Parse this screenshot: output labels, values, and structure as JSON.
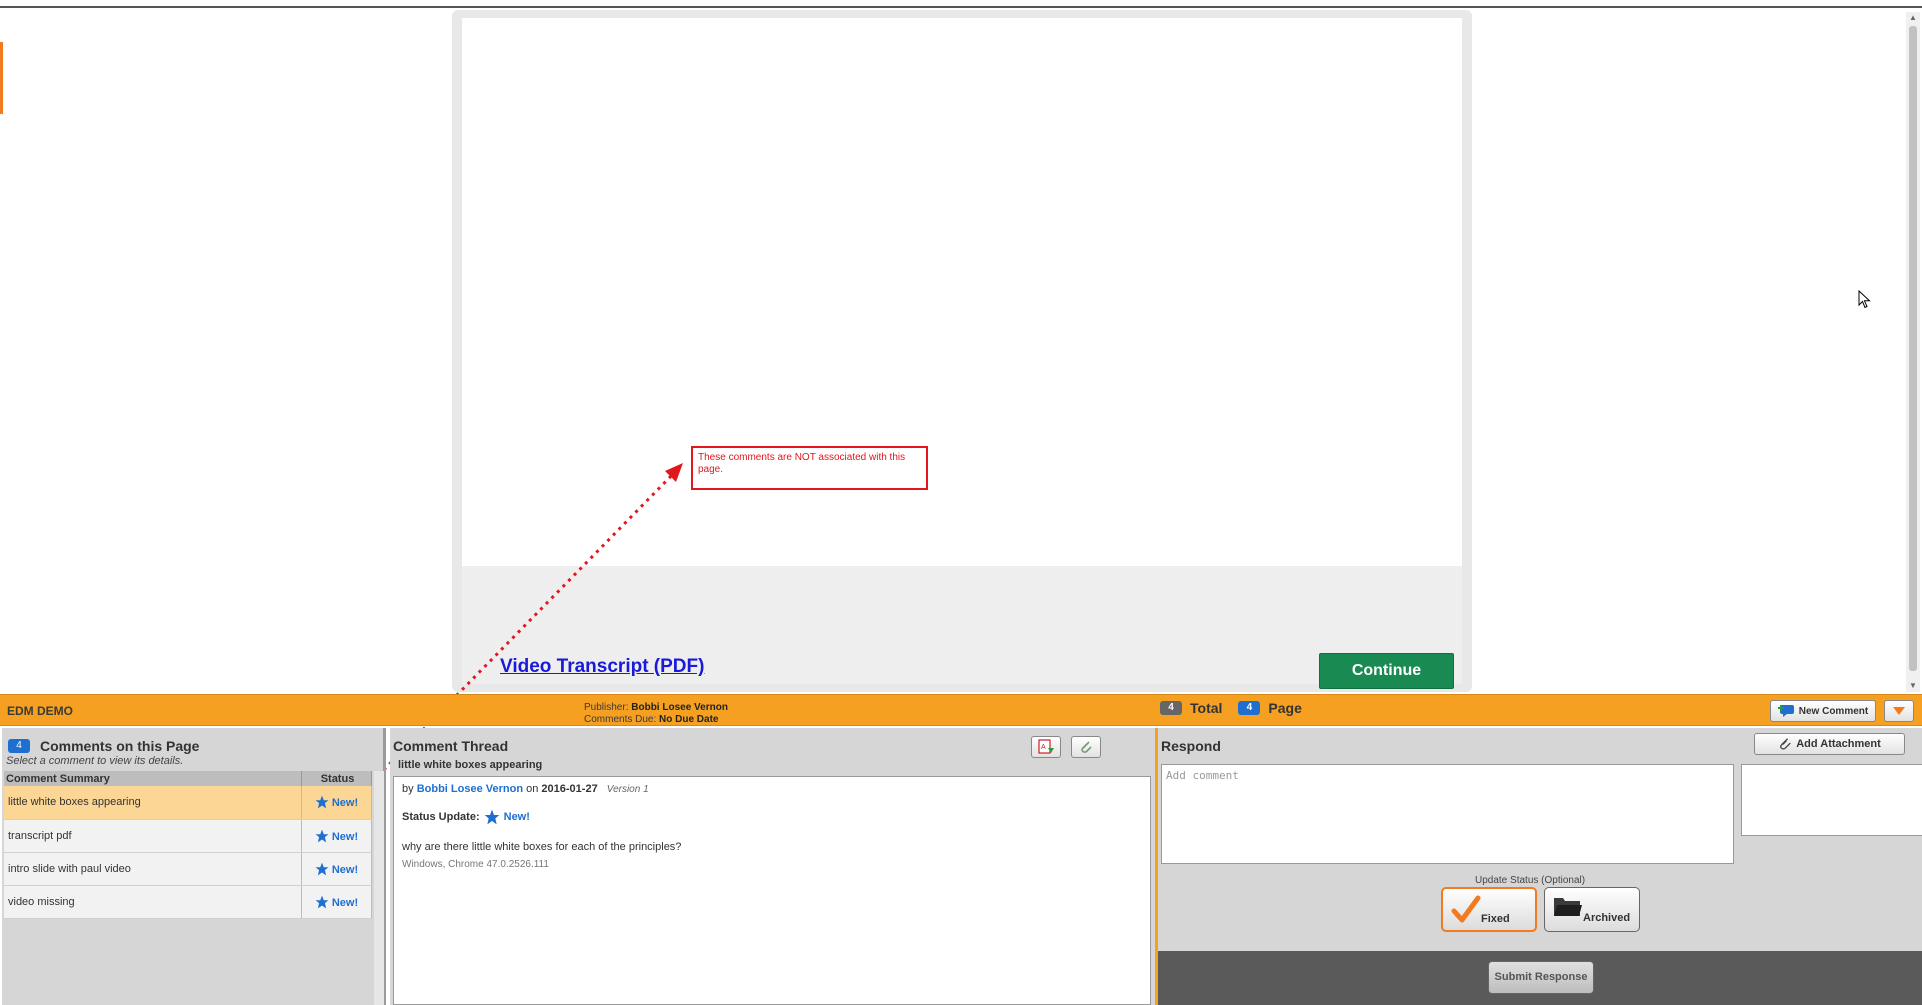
{
  "content": {
    "transcript_link": "Video Transcript (PDF)",
    "continue_label": "Continue",
    "note": "These comments are NOT associated with this page."
  },
  "toolbar": {
    "app_title": "EDM DEMO",
    "publisher_label": "Publisher:",
    "publisher_name": "Bobbi Losee Vernon",
    "due_label": "Comments Due:",
    "due_value": "No Due Date",
    "total_count": "4",
    "total_label": "Total",
    "page_count": "4",
    "page_label": "Page",
    "new_comment_label": "New Comment"
  },
  "comments_panel": {
    "count": "4",
    "title": "Comments on this Page",
    "subtitle": "Select a comment to view its details.",
    "col_summary": "Comment Summary",
    "col_status": "Status",
    "rows": [
      {
        "summary": "little white boxes appearing",
        "status": "New!"
      },
      {
        "summary": "transcript pdf",
        "status": "New!"
      },
      {
        "summary": "intro slide with paul video",
        "status": "New!"
      },
      {
        "summary": "video missing",
        "status": "New!"
      }
    ]
  },
  "thread_panel": {
    "title": "Comment Thread",
    "subtitle": "little white boxes appearing",
    "by_label": "by",
    "author": "Bobbi Losee Vernon",
    "on_label": "on",
    "date": "2016-01-27",
    "version": "Version 1",
    "status_update_label": "Status Update:",
    "status_value": "New!",
    "body": "why are there little white boxes for each of the principles?",
    "environment": "Windows, Chrome 47.0.2526.111"
  },
  "respond_panel": {
    "title": "Respond",
    "add_attachment_label": "Add Attachment",
    "comment_placeholder": "Add comment",
    "update_status_label": "Update Status (Optional)",
    "fixed_label": "Fixed",
    "archived_label": "Archived",
    "submit_label": "Submit Response"
  },
  "colors": {
    "accent_orange": "#f5a021",
    "continue_green": "#1a8a53",
    "link_blue": "#1a1ad8",
    "badge_blue": "#1f6fd0",
    "annotation_red": "#e3161e",
    "selected_row": "#fbd694"
  },
  "icons": {
    "star": "star-icon",
    "new_comment": "new-comment-icon",
    "attachment": "paperclip-icon",
    "fixed": "checkmark-icon",
    "archived": "folder-icon",
    "collapse": "triangle-down-icon",
    "pdf_export": "pdf-export-icon",
    "attachment_view": "attachment-icon"
  }
}
